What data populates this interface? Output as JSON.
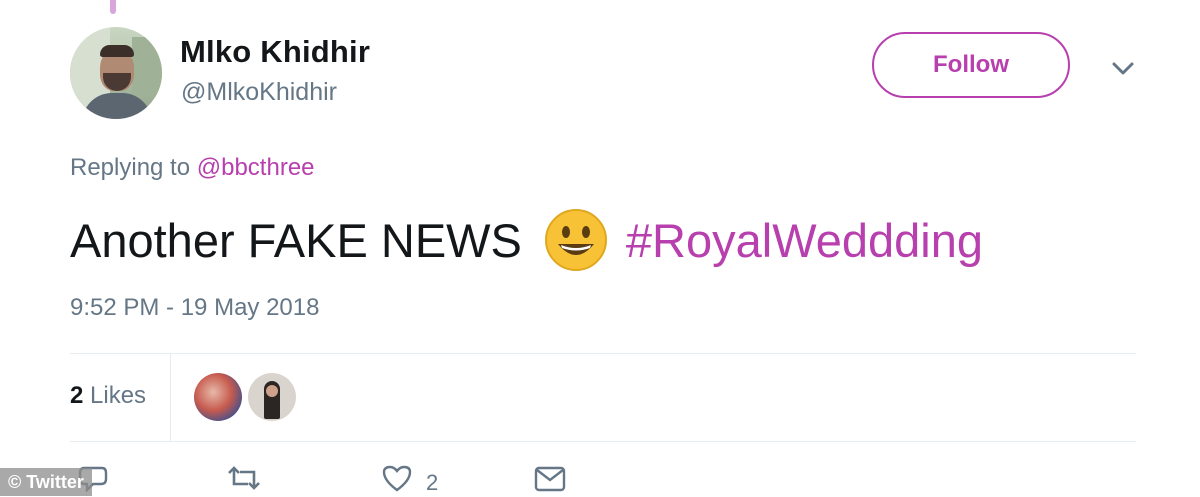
{
  "author": {
    "name": "Mlko Khidhir",
    "handle": "@MlkoKhidhir"
  },
  "follow_button": {
    "label": "Follow"
  },
  "reply_context": {
    "prefix": "Replying to",
    "mention": "@bbcthree"
  },
  "tweet": {
    "text": "Another FAKE NEWS",
    "emoji": "grinning-face",
    "hashtag": "#RoyalWeddding",
    "timestamp": "9:52 PM - 19 May 2018"
  },
  "stats": {
    "likes_count": "2",
    "likes_label": "Likes"
  },
  "actions": {
    "like_count": "2"
  },
  "watermark": {
    "text": "© Twitter"
  },
  "colors": {
    "accent": "#b73fae",
    "secondary_text": "#657786",
    "primary_text": "#14171a",
    "divider": "#e6ecf0"
  }
}
